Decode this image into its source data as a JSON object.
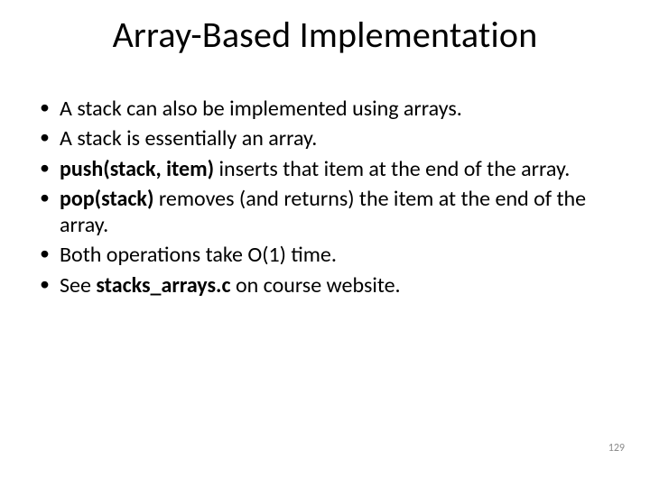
{
  "title": "Array-Based Implementation",
  "bullets": [
    {
      "pre": "",
      "bold": "",
      "post": "A stack can also be implemented using arrays."
    },
    {
      "pre": "",
      "bold": "",
      "post": "A stack is essentially an array."
    },
    {
      "pre": "",
      "bold": "push(stack, item)",
      "post": " inserts that item at the end of the array."
    },
    {
      "pre": "",
      "bold": "pop(stack)",
      "post": " removes (and returns) the item at the end of the array."
    },
    {
      "pre": "",
      "bold": "",
      "post": "Both operations take O(1) time."
    },
    {
      "pre": "See ",
      "bold": "stacks_arrays.c",
      "post": " on course website."
    }
  ],
  "page_number": "129"
}
